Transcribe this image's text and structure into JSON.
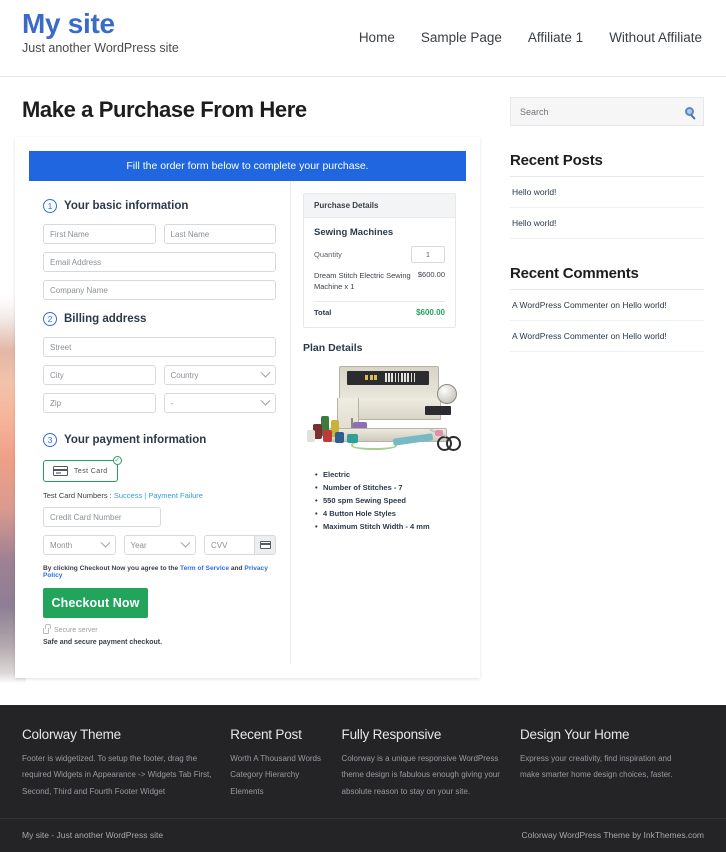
{
  "header": {
    "site_title": "My site",
    "tagline": "Just another WordPress site",
    "nav": [
      {
        "label": "Home"
      },
      {
        "label": "Sample Page"
      },
      {
        "label": "Affiliate 1"
      },
      {
        "label": "Without Affiliate"
      }
    ]
  },
  "main": {
    "page_title": "Make a Purchase From Here",
    "banner": "Fill the order form below to complete your purchase.",
    "steps": {
      "one": {
        "num": "1",
        "label": "Your basic information"
      },
      "two": {
        "num": "2",
        "label": "Billing address"
      },
      "three": {
        "num": "3",
        "label": "Your payment information"
      }
    },
    "fields": {
      "first_name": "First Name",
      "last_name": "Last Name",
      "email": "Email Address",
      "company": "Company Name",
      "street": "Street",
      "city": "City",
      "country": "Country",
      "zip": "Zip",
      "state": "-",
      "credit_card": "Credit Card Number",
      "month": "Month",
      "year": "Year",
      "cvv": "CVV"
    },
    "payment": {
      "chip_label": "Test  Card",
      "chip_check": "✓",
      "test_prefix": "Test Card Numbers : ",
      "test_success": "Success",
      "test_divider": " | ",
      "test_failure": "Payment Failure",
      "terms_prefix": "By clicking Checkout Now you agree to the ",
      "terms_link_1": "Term of Service",
      "terms_and": " and ",
      "terms_link_2": "Privacy Policy",
      "checkout_label": "Checkout Now",
      "secure_server": "Secure server",
      "safe_note": "Safe and secure payment checkout."
    },
    "summary": {
      "head": "Purchase Details",
      "product_group": "Sewing Machines",
      "quantity_label": "Quantity",
      "quantity_value": "1",
      "item_name": "Dream Stitch Electric Sewing Machine x 1",
      "item_price": "$600.00",
      "total_label": "Total",
      "total_value": "$600.00"
    },
    "plan": {
      "title": "Plan Details",
      "features": [
        "Electric",
        "Number of Stitches - 7",
        "550 spm Sewing Speed",
        "4 Button Hole Styles",
        "Maximum Stitch Width - 4 mm"
      ]
    }
  },
  "sidebar": {
    "search_placeholder": "Search",
    "widgets": [
      {
        "title": "Recent Posts",
        "items": [
          "Hello world!",
          "Hello world!"
        ]
      },
      {
        "title": "Recent Comments",
        "items": [
          "A WordPress Commenter on Hello world!",
          "A WordPress Commenter on Hello world!"
        ]
      }
    ]
  },
  "footer": {
    "columns": [
      {
        "title": "Colorway Theme",
        "text": "Footer is widgetized. To setup the footer, drag the required Widgets in Appearance -> Widgets Tab First, Second, Third and Fourth Footer Widget"
      },
      {
        "title": "Recent Post",
        "items": [
          "Worth A Thousand Words",
          "Category Hierarchy",
          "Elements"
        ]
      },
      {
        "title": "Fully Responsive",
        "text": "Colorway is a unique responsive WordPress theme design is fabulous enough giving your absolute reason to stay on your site."
      },
      {
        "title": "Design Your Home",
        "text": "Express your creativity, find inspiration and make smarter home design choices, faster."
      }
    ],
    "bar_left": "My site - Just another WordPress site",
    "bar_right": "Colorway WordPress Theme by InkThemes.com"
  },
  "colors": {
    "brand_blue": "#3a6bc5",
    "banner_blue": "#1f66e0",
    "accent_green": "#22a45d",
    "footer_bg": "#242427"
  }
}
